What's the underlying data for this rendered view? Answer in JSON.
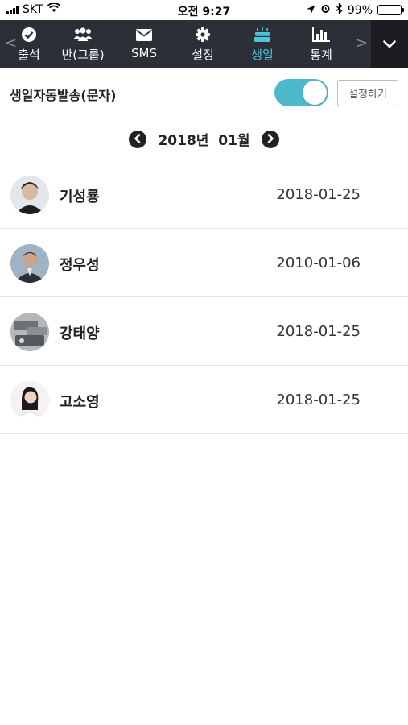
{
  "status_bar": {
    "carrier": "SKT",
    "time": "오전 9:27",
    "battery": "99%",
    "battery_level": 0.99
  },
  "nav": {
    "tabs": [
      {
        "label": "출석",
        "icon": "check-circle-icon",
        "active": false
      },
      {
        "label": "반(그룹)",
        "icon": "group-icon",
        "active": false
      },
      {
        "label": "SMS",
        "icon": "envelope-icon",
        "active": false
      },
      {
        "label": "설정",
        "icon": "gear-icon",
        "active": false
      },
      {
        "label": "생일",
        "icon": "cake-icon",
        "active": true
      },
      {
        "label": "통계",
        "icon": "bar-chart-icon",
        "active": false
      }
    ],
    "active_color": "#4fc6d8",
    "background": "#2c2f38"
  },
  "auto_send": {
    "label": "생일자동발송(문자)",
    "enabled": true,
    "button_label": "설정하기",
    "toggle_color": "#4fb9cc"
  },
  "month_nav": {
    "label": "2018년  01월"
  },
  "birthdays": [
    {
      "name": "기성룡",
      "date": "2018-01-25"
    },
    {
      "name": "정우성",
      "date": "2010-01-06"
    },
    {
      "name": "강태양",
      "date": "2018-01-25"
    },
    {
      "name": "고소영",
      "date": "2018-01-25"
    }
  ]
}
